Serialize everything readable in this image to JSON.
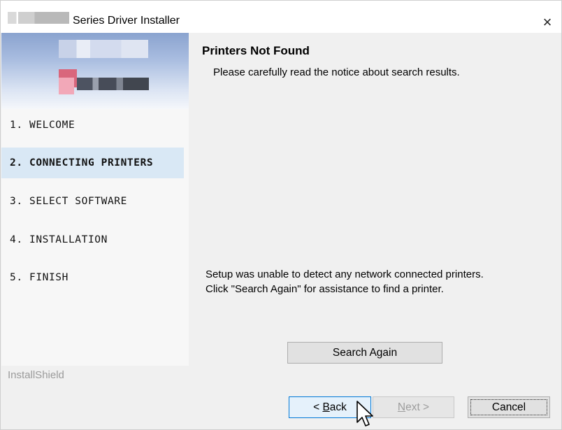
{
  "window": {
    "title": "Series Driver Installer",
    "close_glyph": "×"
  },
  "sidebar": {
    "steps": [
      {
        "label": "1. WELCOME",
        "active": false
      },
      {
        "label": "2. CONNECTING PRINTERS",
        "active": true
      },
      {
        "label": "3. SELECT SOFTWARE",
        "active": false
      },
      {
        "label": "4. INSTALLATION",
        "active": false
      },
      {
        "label": "5. FINISH",
        "active": false
      }
    ],
    "footer_brand": "InstallShield"
  },
  "content": {
    "title": "Printers Not Found",
    "subtitle": "Please carefully read the notice about search results.",
    "message_line1": "Setup was unable to detect any network connected printers.",
    "message_line2": "Click \"Search Again\" for assistance to find a printer."
  },
  "buttons": {
    "search_again": "Search Again",
    "back_prefix": "< ",
    "back_mnemonic": "B",
    "back_rest": "ack",
    "next_mnemonic": "N",
    "next_rest": "ext >",
    "cancel": "Cancel"
  },
  "colors": {
    "active_step_bg": "#d9e8f5",
    "focus_border": "#0078d7"
  }
}
